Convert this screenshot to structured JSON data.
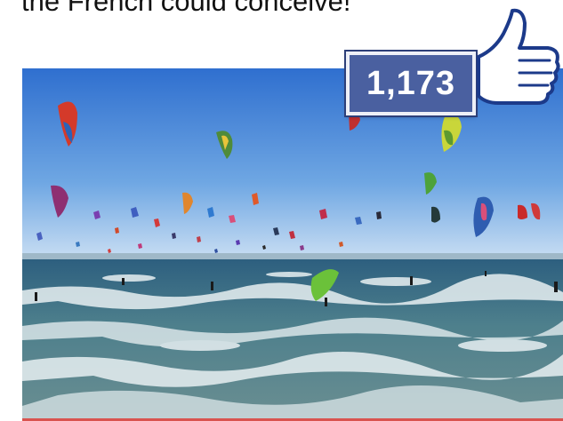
{
  "article": {
    "headline_text": "the French could conceive!"
  },
  "like_badge": {
    "count": "1,173",
    "icon": "thumbs-up-icon"
  },
  "photo": {
    "subject": "kitesurfing-scene"
  },
  "colors": {
    "badge_blue": "#4a60a0",
    "sky_blue": "#3f7fd3",
    "sea_teal": "#3b6f7c"
  }
}
